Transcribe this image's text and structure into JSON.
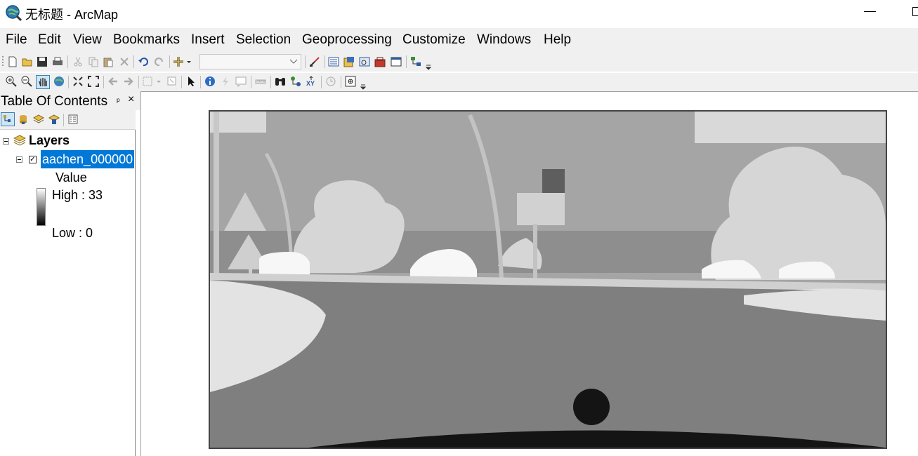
{
  "window": {
    "title": "无标题 - ArcMap",
    "app_icon": "arcmap-globe-icon"
  },
  "menubar": {
    "items": [
      "File",
      "Edit",
      "View",
      "Bookmarks",
      "Insert",
      "Selection",
      "Geoprocessing",
      "Customize",
      "Windows",
      "Help"
    ]
  },
  "toolbar": {
    "scale_combo_value": "",
    "standard_icons": [
      "new-document-icon",
      "open-icon",
      "save-icon",
      "print-icon",
      "cut-icon",
      "copy-icon",
      "paste-icon",
      "delete-icon",
      "undo-icon",
      "redo-icon",
      "add-data-icon",
      "scale-combo",
      "editor-toolbar-icon",
      "table-of-contents-icon",
      "catalog-icon",
      "search-window-icon",
      "arctoolbox-icon",
      "python-window-icon",
      "model-builder-icon"
    ],
    "tools_icons": [
      "zoom-in-icon",
      "zoom-out-icon",
      "pan-icon",
      "full-extent-icon",
      "fixed-zoom-in-icon",
      "fixed-zoom-out-icon",
      "back-extent-icon",
      "forward-extent-icon",
      "select-features-icon",
      "clear-selection-icon",
      "select-elements-icon",
      "identify-icon",
      "hyperlink-icon",
      "html-popup-icon",
      "measure-icon",
      "find-icon",
      "find-route-icon",
      "go-to-xy-icon",
      "time-slider-icon",
      "create-viewer-window-icon"
    ]
  },
  "toc": {
    "title": "Table Of Contents",
    "pin_glyph": "ᵖ",
    "close_glyph": "×",
    "tools": [
      "list-by-drawing-order-icon",
      "list-by-source-icon",
      "list-by-visibility-icon",
      "list-by-selection-icon",
      "options-icon"
    ],
    "data_frame": "Layers",
    "layer": {
      "name": "aachen_000000",
      "checked": true,
      "legend_heading": "Value",
      "high_label": "High : 33",
      "low_label": "Low : 0"
    }
  },
  "map": {
    "description_colors": {
      "sky": "#9b9b9b",
      "road": "#7f7f7f",
      "sidewalk": "#e3e3e3",
      "car_hood": "#141414"
    }
  }
}
